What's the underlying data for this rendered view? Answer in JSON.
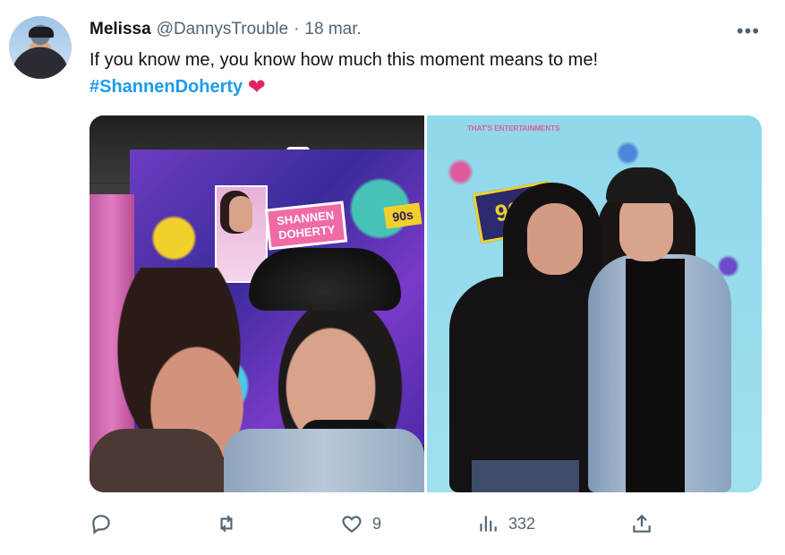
{
  "tweet": {
    "author_name": "Melissa",
    "author_handle": "@DannysTrouble",
    "separator": "·",
    "date": "18 mar.",
    "more_label": "•••",
    "text": "If you know me, you know how much this moment means to me!",
    "hashtag": "#ShannenDoherty",
    "emoji": "❤"
  },
  "media": {
    "photo1": {
      "banner_logo": "SHANNEN DOHERTY",
      "badge": "90s"
    },
    "photo2": {
      "brand_text": "THAT'S ENTERTAINMENTS",
      "badge": "90s"
    }
  },
  "actions": {
    "reply": {
      "icon": "reply-icon",
      "count": ""
    },
    "retweet": {
      "icon": "retweet-icon",
      "count": ""
    },
    "like": {
      "icon": "heart-icon",
      "count": "9"
    },
    "views": {
      "icon": "views-icon",
      "count": "332"
    },
    "share": {
      "icon": "share-icon"
    }
  },
  "colors": {
    "text": "#0f1419",
    "secondary": "#536471",
    "link": "#1d9bf0",
    "heart": "#e0245e"
  }
}
